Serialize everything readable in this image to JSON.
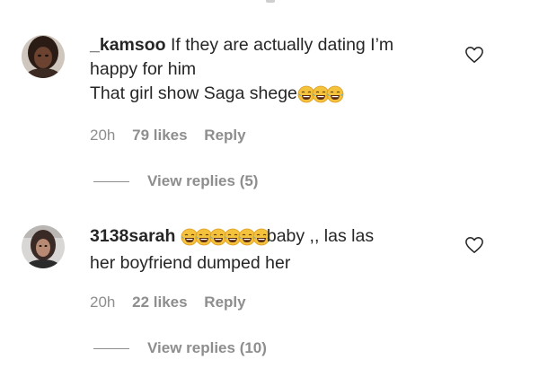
{
  "comments": [
    {
      "username": "_kamsoo",
      "line1": "If they are actually dating I’m",
      "line2": "happy for him",
      "line3": "That girl show Saga shege",
      "emoji_icons": [
        "face-with-tears-of-joy-icon",
        "face-with-tears-of-joy-icon",
        "face-with-tears-of-joy-icon"
      ],
      "time": "20h",
      "likes": "79 likes",
      "reply": "Reply",
      "view_replies": "View replies (5)"
    },
    {
      "username": "3138sarah",
      "line1_tail": "baby ,, las las",
      "line2": "her boyfriend dumped her",
      "emoji_icons": [
        "face-with-tears-of-joy-icon",
        "face-with-tears-of-joy-icon",
        "face-with-tears-of-joy-icon",
        "face-with-tears-of-joy-icon",
        "face-with-tears-of-joy-icon",
        "face-with-tears-of-joy-icon"
      ],
      "time": "20h",
      "likes": "22 likes",
      "reply": "Reply",
      "view_replies": "View replies (10)"
    }
  ],
  "colors": {
    "text": "#262626",
    "secondary": "#8e8e8e",
    "emoji_face": "#f5c33b",
    "emoji_tear": "#5ab0e8"
  }
}
